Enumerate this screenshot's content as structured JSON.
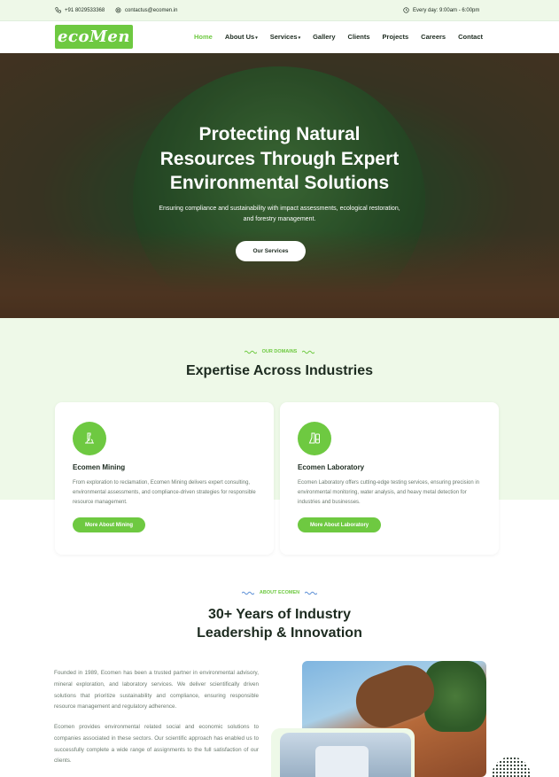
{
  "topbar": {
    "phone": "+91 8029533368",
    "email": "contactus@ecomen.in",
    "hours": "Every day: 9:00am - 6:00pm"
  },
  "nav": {
    "logo_text": "ecoMen",
    "items": [
      {
        "label": "Home",
        "active": true,
        "dropdown": false
      },
      {
        "label": "About Us",
        "active": false,
        "dropdown": true
      },
      {
        "label": "Services",
        "active": false,
        "dropdown": true
      },
      {
        "label": "Gallery",
        "active": false,
        "dropdown": false
      },
      {
        "label": "Clients",
        "active": false,
        "dropdown": false
      },
      {
        "label": "Projects",
        "active": false,
        "dropdown": false
      },
      {
        "label": "Careers",
        "active": false,
        "dropdown": false
      },
      {
        "label": "Contact",
        "active": false,
        "dropdown": false
      }
    ]
  },
  "hero": {
    "title_line1": "Protecting Natural",
    "title_line2": "Resources Through Expert",
    "title_line3": "Environmental Solutions",
    "subtitle_line1": "Ensuring compliance and sustainability with impact assessments, ecological restoration,",
    "subtitle_line2": "and forestry management.",
    "cta": "Our Services"
  },
  "domains": {
    "eyebrow": "OUR DOMAINS",
    "heading": "Expertise Across Industries",
    "cards": [
      {
        "title": "Ecomen Mining",
        "description": "From exploration to reclamation, Ecomen Mining delivers expert consulting, environmental assessments, and compliance-driven strategies for responsible resource management.",
        "button": "More About Mining",
        "icon": "microscope-icon"
      },
      {
        "title": "Ecomen Laboratory",
        "description": "Ecomen Laboratory offers cutting-edge testing services, ensuring precision in environmental monitoring, water analysis, and heavy metal detection for industries and businesses.",
        "button": "More About Laboratory",
        "icon": "lab-flask-icon"
      }
    ]
  },
  "about": {
    "eyebrow": "ABOUT ECOMEN",
    "heading_line1": "30+ Years of Industry",
    "heading_line2": "Leadership & Innovation",
    "paragraph1": "Founded in 1989, Ecomen has been a trusted partner in environmental advisory, mineral exploration, and laboratory services. We deliver scientifically driven solutions that prioritize sustainability and compliance, ensuring responsible resource management and regulatory adherence.",
    "paragraph2": "Ecomen provides environmental related social and economic solutions to companies associated in these sectors. Our scientific approach has enabled us to successfully complete a wide range of assignments to the full satisfaction of our clients."
  },
  "colors": {
    "accent": "#6ec941",
    "dark": "#1d2b20",
    "light_green_bg": "#eef9e8"
  }
}
